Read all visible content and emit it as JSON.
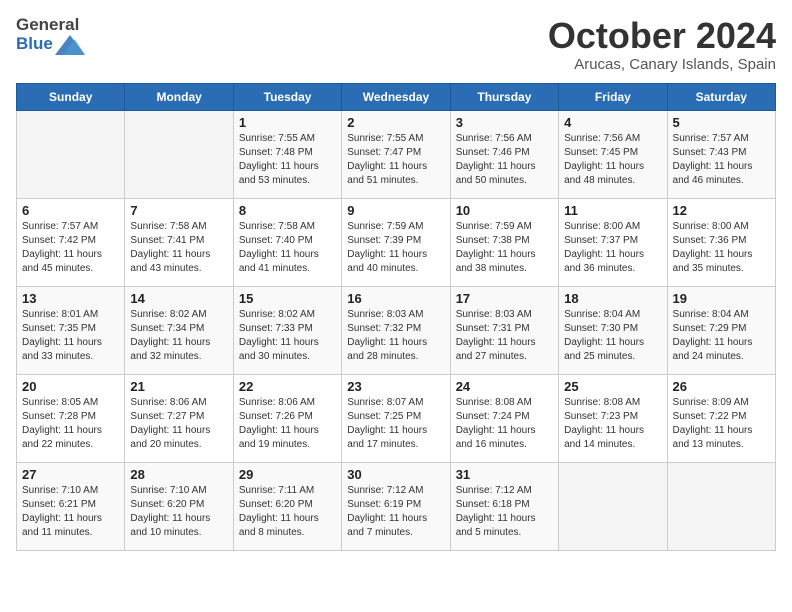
{
  "header": {
    "logo_general": "General",
    "logo_blue": "Blue",
    "month_title": "October 2024",
    "location": "Arucas, Canary Islands, Spain"
  },
  "weekdays": [
    "Sunday",
    "Monday",
    "Tuesday",
    "Wednesday",
    "Thursday",
    "Friday",
    "Saturday"
  ],
  "weeks": [
    [
      null,
      null,
      {
        "day": "1",
        "sunrise": "7:55 AM",
        "sunset": "7:48 PM",
        "daylight": "11 hours and 53 minutes."
      },
      {
        "day": "2",
        "sunrise": "7:55 AM",
        "sunset": "7:47 PM",
        "daylight": "11 hours and 51 minutes."
      },
      {
        "day": "3",
        "sunrise": "7:56 AM",
        "sunset": "7:46 PM",
        "daylight": "11 hours and 50 minutes."
      },
      {
        "day": "4",
        "sunrise": "7:56 AM",
        "sunset": "7:45 PM",
        "daylight": "11 hours and 48 minutes."
      },
      {
        "day": "5",
        "sunrise": "7:57 AM",
        "sunset": "7:43 PM",
        "daylight": "11 hours and 46 minutes."
      }
    ],
    [
      {
        "day": "6",
        "sunrise": "7:57 AM",
        "sunset": "7:42 PM",
        "daylight": "11 hours and 45 minutes."
      },
      {
        "day": "7",
        "sunrise": "7:58 AM",
        "sunset": "7:41 PM",
        "daylight": "11 hours and 43 minutes."
      },
      {
        "day": "8",
        "sunrise": "7:58 AM",
        "sunset": "7:40 PM",
        "daylight": "11 hours and 41 minutes."
      },
      {
        "day": "9",
        "sunrise": "7:59 AM",
        "sunset": "7:39 PM",
        "daylight": "11 hours and 40 minutes."
      },
      {
        "day": "10",
        "sunrise": "7:59 AM",
        "sunset": "7:38 PM",
        "daylight": "11 hours and 38 minutes."
      },
      {
        "day": "11",
        "sunrise": "8:00 AM",
        "sunset": "7:37 PM",
        "daylight": "11 hours and 36 minutes."
      },
      {
        "day": "12",
        "sunrise": "8:00 AM",
        "sunset": "7:36 PM",
        "daylight": "11 hours and 35 minutes."
      }
    ],
    [
      {
        "day": "13",
        "sunrise": "8:01 AM",
        "sunset": "7:35 PM",
        "daylight": "11 hours and 33 minutes."
      },
      {
        "day": "14",
        "sunrise": "8:02 AM",
        "sunset": "7:34 PM",
        "daylight": "11 hours and 32 minutes."
      },
      {
        "day": "15",
        "sunrise": "8:02 AM",
        "sunset": "7:33 PM",
        "daylight": "11 hours and 30 minutes."
      },
      {
        "day": "16",
        "sunrise": "8:03 AM",
        "sunset": "7:32 PM",
        "daylight": "11 hours and 28 minutes."
      },
      {
        "day": "17",
        "sunrise": "8:03 AM",
        "sunset": "7:31 PM",
        "daylight": "11 hours and 27 minutes."
      },
      {
        "day": "18",
        "sunrise": "8:04 AM",
        "sunset": "7:30 PM",
        "daylight": "11 hours and 25 minutes."
      },
      {
        "day": "19",
        "sunrise": "8:04 AM",
        "sunset": "7:29 PM",
        "daylight": "11 hours and 24 minutes."
      }
    ],
    [
      {
        "day": "20",
        "sunrise": "8:05 AM",
        "sunset": "7:28 PM",
        "daylight": "11 hours and 22 minutes."
      },
      {
        "day": "21",
        "sunrise": "8:06 AM",
        "sunset": "7:27 PM",
        "daylight": "11 hours and 20 minutes."
      },
      {
        "day": "22",
        "sunrise": "8:06 AM",
        "sunset": "7:26 PM",
        "daylight": "11 hours and 19 minutes."
      },
      {
        "day": "23",
        "sunrise": "8:07 AM",
        "sunset": "7:25 PM",
        "daylight": "11 hours and 17 minutes."
      },
      {
        "day": "24",
        "sunrise": "8:08 AM",
        "sunset": "7:24 PM",
        "daylight": "11 hours and 16 minutes."
      },
      {
        "day": "25",
        "sunrise": "8:08 AM",
        "sunset": "7:23 PM",
        "daylight": "11 hours and 14 minutes."
      },
      {
        "day": "26",
        "sunrise": "8:09 AM",
        "sunset": "7:22 PM",
        "daylight": "11 hours and 13 minutes."
      }
    ],
    [
      {
        "day": "27",
        "sunrise": "7:10 AM",
        "sunset": "6:21 PM",
        "daylight": "11 hours and 11 minutes."
      },
      {
        "day": "28",
        "sunrise": "7:10 AM",
        "sunset": "6:20 PM",
        "daylight": "11 hours and 10 minutes."
      },
      {
        "day": "29",
        "sunrise": "7:11 AM",
        "sunset": "6:20 PM",
        "daylight": "11 hours and 8 minutes."
      },
      {
        "day": "30",
        "sunrise": "7:12 AM",
        "sunset": "6:19 PM",
        "daylight": "11 hours and 7 minutes."
      },
      {
        "day": "31",
        "sunrise": "7:12 AM",
        "sunset": "6:18 PM",
        "daylight": "11 hours and 5 minutes."
      },
      null,
      null
    ]
  ]
}
